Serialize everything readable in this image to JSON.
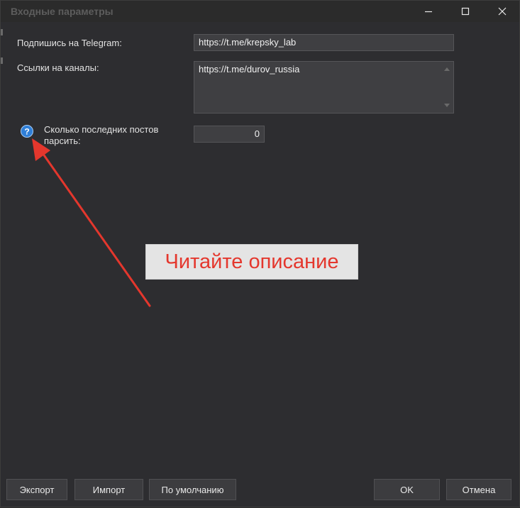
{
  "window": {
    "title": "Входные параметры"
  },
  "form": {
    "telegram_label": "Подпишись на Telegram:",
    "telegram_value": "https://t.me/krepsky_lab",
    "channels_label": "Ссылки на каналы:",
    "channels_value": "https://t.me/durov_russia",
    "posts_label_line1": "Сколько последних постов",
    "posts_label_line2": "парсить:",
    "posts_value": "0"
  },
  "annotation": {
    "callout_text": "Читайте описание",
    "color": "#e4372d"
  },
  "buttons": {
    "export": "Экспорт",
    "import": "Импорт",
    "defaults": "По умолчанию",
    "ok": "OK",
    "cancel": "Отмена"
  },
  "icons": {
    "help": "question-circle-icon",
    "minimize": "minimize-icon",
    "maximize": "maximize-icon",
    "close": "close-icon"
  }
}
